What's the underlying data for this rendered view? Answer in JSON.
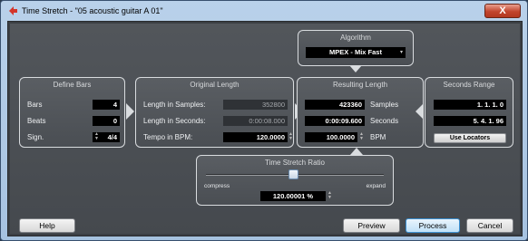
{
  "window": {
    "title": "Time Stretch - \"05 acoustic guitar A 01\"",
    "close_label": "X"
  },
  "algorithm": {
    "title": "Algorithm",
    "selected": "MPEX - Mix Fast"
  },
  "define_bars": {
    "title": "Define Bars",
    "bars_label": "Bars",
    "bars_value": "4",
    "beats_label": "Beats",
    "beats_value": "0",
    "sign_label": "Sign.",
    "sign_value": "4/4"
  },
  "original_length": {
    "title": "Original Length",
    "samples_label": "Length in Samples:",
    "samples_value": "352800",
    "seconds_label": "Length in Seconds:",
    "seconds_value": "0:00:08.000",
    "bpm_label": "Tempo in BPM:",
    "bpm_value": "120.0000"
  },
  "resulting_length": {
    "title": "Resulting Length",
    "samples_value": "423360",
    "samples_label": "Samples",
    "seconds_value": "0:00:09.600",
    "seconds_label": "Seconds",
    "bpm_value": "100.0000",
    "bpm_label": "BPM"
  },
  "seconds_range": {
    "title": "Seconds Range",
    "start_value": "1. 1. 1.   0",
    "end_value": "5. 4. 1. 96",
    "use_locators_label": "Use Locators"
  },
  "ratio": {
    "title": "Time Stretch Ratio",
    "compress_label": "compress",
    "expand_label": "expand",
    "value": "120.00001 %",
    "slider_position": 0.49
  },
  "buttons": {
    "help": "Help",
    "preview": "Preview",
    "process": "Process",
    "cancel": "Cancel"
  }
}
